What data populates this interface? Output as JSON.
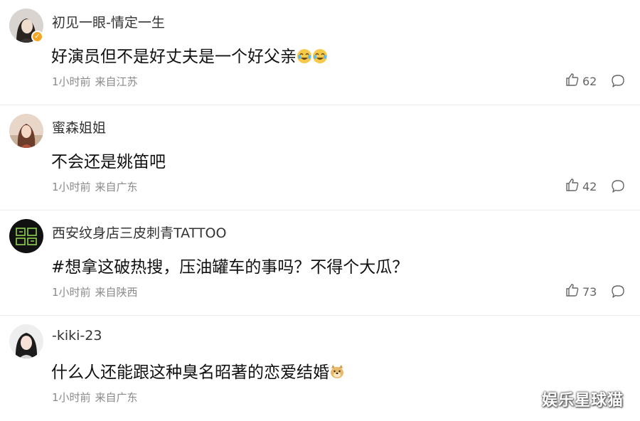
{
  "comments": [
    {
      "username": "初见一眼-情定一生",
      "text": "好演员但不是好丈夫是一个好父亲",
      "time": "1小时前",
      "location": "来自江苏",
      "likes": "62",
      "avatar_icon": "woman-portrait-avatar",
      "verified": true,
      "emojis": [
        "laugh-tears-emoji",
        "laugh-tears-emoji"
      ]
    },
    {
      "username": "蜜森姐姐",
      "text": "不会还是姚笛吧",
      "time": "1小时前",
      "location": "来自广东",
      "likes": "42",
      "avatar_icon": "woman-photo-avatar"
    },
    {
      "username": "西安纹身店三皮刺青TATTOO",
      "text": "#想拿这破热搜，压油罐车的事吗？不得个大瓜？",
      "time": "1小时前",
      "location": "来自陕西",
      "likes": "73",
      "avatar_icon": "tattoo-shop-logo-avatar"
    },
    {
      "username": "-kiki-23",
      "text": "什么人还能跟这种臭名昭著的恋爱结婚",
      "time": "1小时前",
      "location": "来自广东",
      "avatar_icon": "girl-portrait-avatar",
      "emojis": [
        "doge-emoji"
      ]
    }
  ],
  "watermark": "娱乐星球猫",
  "colors": {
    "text": "#111111",
    "meta": "#8a8a8a",
    "verified_badge": "#f5a623",
    "divider": "#ececec"
  }
}
